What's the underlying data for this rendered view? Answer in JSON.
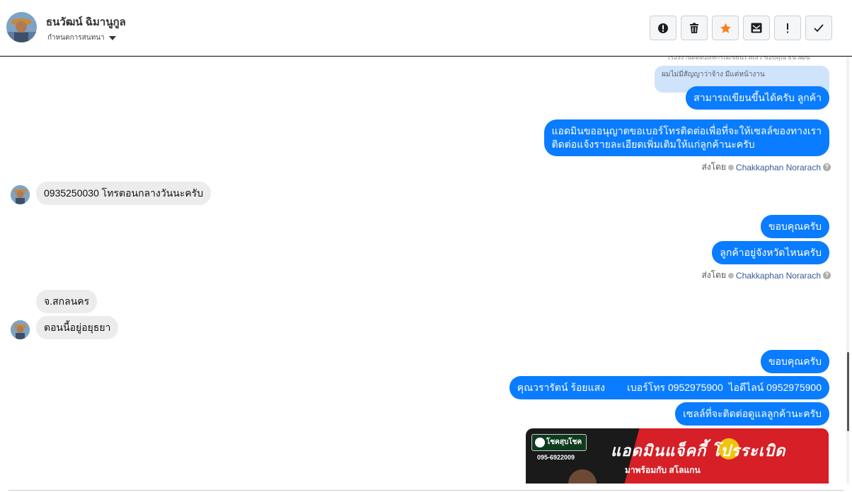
{
  "header": {
    "contact_name": "ธนวัฒน์ ฉิมานูกูล",
    "assign_label": "กำหนดการสนทนา",
    "toolbar": [
      {
        "name": "report-button",
        "icon": "alert-circle-icon"
      },
      {
        "name": "delete-button",
        "icon": "trash-icon"
      },
      {
        "name": "star-button",
        "icon": "star-icon"
      },
      {
        "name": "mark-unread-button",
        "icon": "envelope-icon"
      },
      {
        "name": "important-button",
        "icon": "exclamation-icon"
      },
      {
        "name": "done-button",
        "icon": "check-icon"
      }
    ]
  },
  "colors": {
    "outgoing": "#0a7cff",
    "incoming": "#ececec",
    "quote": "#cfe3fb",
    "star": "#f7811d"
  },
  "messages": {
    "clipped_top": "เรื่องงานติดต่อสหกรณ์เขียนไว้แล้ว ขอบคุณ ธนวัฒน์",
    "quote": "ผมไม่มีสัญญาว่าจ้าง มีแต่หน้างาน",
    "m1": "สามารถเขียนขึ้นได้ครับ ลูกค้า",
    "m2_line1": "แอดมินขออนุญาตขอเบอร์โทรติดต่อเพื่อที่จะให้เซลล์ของทางเรา",
    "m2_line2": "ติดต่อแจ้งรายละเอียดเพิ่มเติมให้แก่ลูกค้านะครับ",
    "sent_by_label": "ส่งโดย",
    "agent": "Chakkaphan Norarach",
    "in1": "0935250030 โทรตอนกลางวันนะครับ",
    "m3": "ขอบคุณครับ",
    "m4": "ลูกค้าอยู่จังหวัดไหนครับ",
    "in2": "จ.สกลนคร",
    "in3": "ตอนนี้อยู่อยุธยา",
    "m5": "ขอบคุณครับ",
    "m6": "คุณวรารัตน์ ร้อยแสง        เบอร์โทร 0952975900  ไอดีไลน์ 0952975900",
    "m7": "เซลล์ที่จะติดต่อดูแลลูกค้านะครับ"
  },
  "banner": {
    "logo_text": "โชคสุบโชค",
    "phone": "095-6922009",
    "headline": "แอดมินแจ็คกี้ โปรระเบิด",
    "subline": "มาพร้อมกับ สโลแกน"
  }
}
